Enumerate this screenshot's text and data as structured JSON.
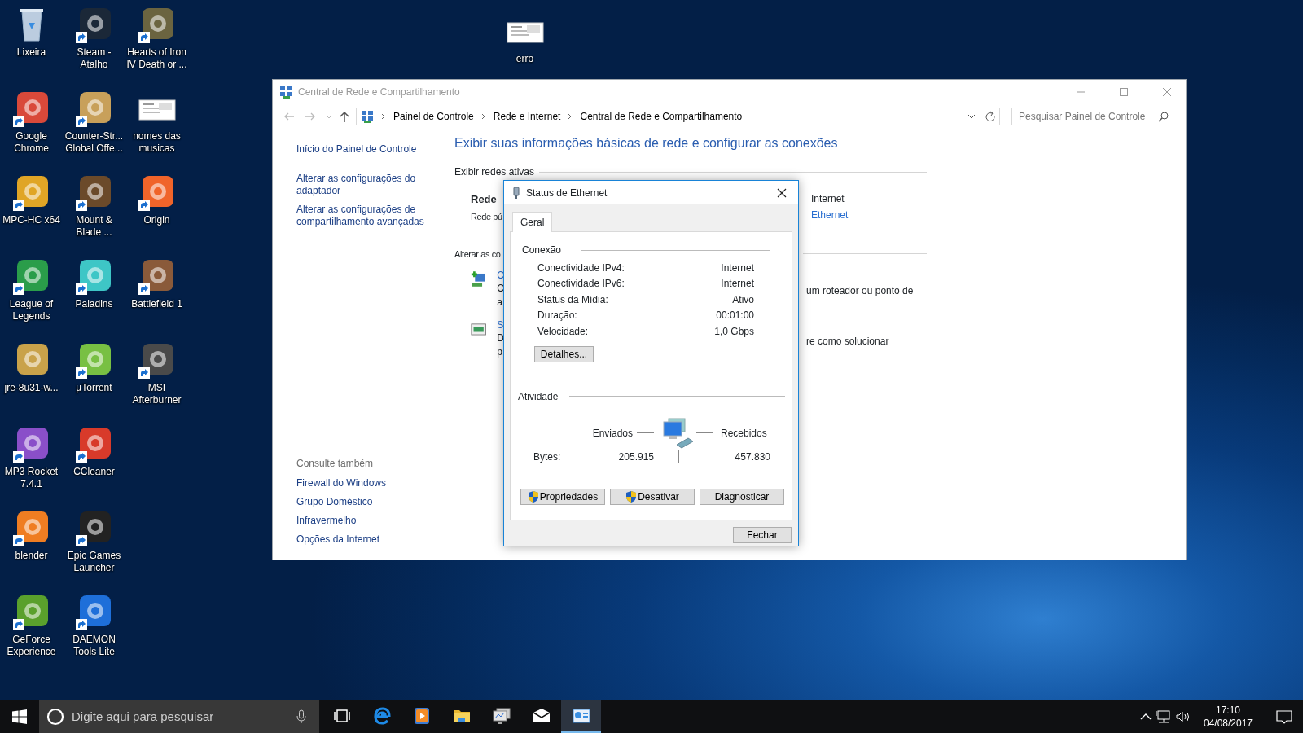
{
  "desktop": {
    "icons": [
      {
        "label": "Lixeira",
        "kind": "bin",
        "shortcut": false
      },
      {
        "label": "Google Chrome",
        "kind": "app",
        "shortcut": true
      },
      {
        "label": "MPC-HC x64",
        "kind": "app",
        "shortcut": true
      },
      {
        "label": "League of Legends",
        "kind": "app",
        "shortcut": true
      },
      {
        "label": "jre-8u31-w...",
        "kind": "app",
        "shortcut": false
      },
      {
        "label": "MP3 Rocket 7.4.1",
        "kind": "app",
        "shortcut": true
      },
      {
        "label": "blender",
        "kind": "app",
        "shortcut": true
      },
      {
        "label": "GeForce Experience",
        "kind": "app",
        "shortcut": true
      },
      {
        "label": "Steam - Atalho",
        "kind": "app",
        "shortcut": true
      },
      {
        "label": "Counter-Str... Global Offe...",
        "kind": "app",
        "shortcut": true
      },
      {
        "label": "Mount & Blade ...",
        "kind": "app",
        "shortcut": true
      },
      {
        "label": "Paladins",
        "kind": "app",
        "shortcut": true
      },
      {
        "label": "µTorrent",
        "kind": "app",
        "shortcut": true
      },
      {
        "label": "CCleaner",
        "kind": "app",
        "shortcut": true
      },
      {
        "label": "Epic Games Launcher",
        "kind": "app",
        "shortcut": true
      },
      {
        "label": "DAEMON Tools Lite",
        "kind": "app",
        "shortcut": true
      },
      {
        "label": "Hearts of Iron IV Death or ...",
        "kind": "app",
        "shortcut": true
      },
      {
        "label": "nomes das musicas",
        "kind": "document",
        "shortcut": false
      },
      {
        "label": "Origin",
        "kind": "app",
        "shortcut": true
      },
      {
        "label": "Battlefield 1",
        "kind": "app",
        "shortcut": true
      },
      {
        "label": "MSI Afterburner",
        "kind": "app",
        "shortcut": true
      }
    ],
    "loose_icons": [
      {
        "label": "erro",
        "kind": "document",
        "shortcut": false
      }
    ]
  },
  "window": {
    "title": "Central de Rede e Compartilhamento",
    "breadcrumb": [
      "Painel de Controle",
      "Rede e Internet",
      "Central de Rede e Compartilhamento"
    ],
    "search": {
      "placeholder": "Pesquisar Painel de Controle"
    },
    "sidebar": {
      "links": [
        "Início do Painel de Controle",
        "Alterar as configurações do adaptador",
        "Alterar as configurações de compartilhamento avançadas"
      ],
      "see_also_title": "Consulte também",
      "see_also": [
        "Firewall do Windows",
        "Grupo Doméstico",
        "Infravermelho",
        "Opções da Internet"
      ]
    },
    "main": {
      "heading": "Exibir suas informações básicas de rede e configurar as conexões",
      "active_networks_label": "Exibir redes ativas",
      "network_name": "Rede",
      "network_type": "Rede pú",
      "access_type": "Internet",
      "connection": "Ethernet",
      "change_label": "Alterar as co",
      "tasks": [
        {
          "link": "C",
          "lines": [
            "C",
            "a"
          ],
          "tail": "um roteador ou ponto de"
        },
        {
          "link": "S",
          "lines": [
            "D",
            "p"
          ],
          "tail": "re como solucionar"
        }
      ]
    }
  },
  "dialog": {
    "title": "Status de Ethernet",
    "tabs": [
      {
        "label": "Geral",
        "selected": true
      }
    ],
    "connection": {
      "label": "Conexão",
      "rows": [
        {
          "label": "Conectividade IPv4:",
          "value": "Internet"
        },
        {
          "label": "Conectividade IPv6:",
          "value": "Internet"
        },
        {
          "label": "Status da Mídia:",
          "value": "Ativo"
        },
        {
          "label": "Duração:",
          "value": "00:01:00"
        },
        {
          "label": "Velocidade:",
          "value": "1,0 Gbps"
        }
      ],
      "details_button": "Detalhes..."
    },
    "activity": {
      "label": "Atividade",
      "sent_label": "Enviados",
      "received_label": "Recebidos",
      "bytes_label": "Bytes:",
      "sent": "205.915",
      "received": "457.830"
    },
    "buttons": [
      {
        "label": "Propriedades",
        "shield": true
      },
      {
        "label": "Desativar",
        "shield": true
      },
      {
        "label": "Diagnosticar",
        "shield": false
      }
    ],
    "close_button": "Fechar"
  },
  "taskbar": {
    "search": {
      "placeholder": "Digite aqui para pesquisar"
    },
    "apps": [
      {
        "kind": "browser",
        "active": false
      },
      {
        "kind": "media",
        "active": false
      },
      {
        "kind": "folder",
        "active": false
      },
      {
        "kind": "monitor",
        "active": false
      },
      {
        "kind": "mail",
        "active": false
      },
      {
        "kind": "control",
        "active": true
      }
    ],
    "clock": {
      "time": "17:10",
      "date": "04/08/2017"
    }
  }
}
